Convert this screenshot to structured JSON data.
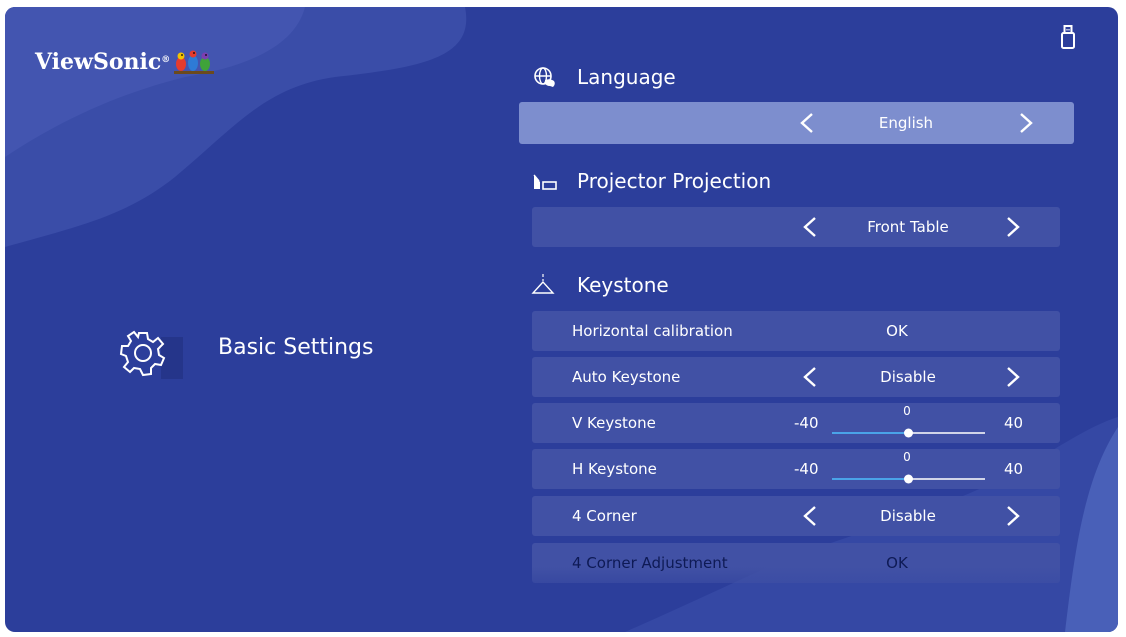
{
  "brand": {
    "name": "ViewSonic",
    "reg": "®",
    "logo_icon": "birds-icon"
  },
  "status": {
    "icon": "usb-icon"
  },
  "page": {
    "title": "Basic Settings",
    "icon": "gear-icon"
  },
  "sections": {
    "language": {
      "title": "Language",
      "icon": "globe-icon",
      "value": "English"
    },
    "projection": {
      "title": "Projector Projection",
      "icon": "projector-icon",
      "value": "Front Table"
    },
    "keystone": {
      "title": "Keystone",
      "icon": "keystone-icon"
    }
  },
  "keystone_rows": {
    "horizontal": {
      "label": "Horizontal calibration",
      "value": "OK"
    },
    "auto": {
      "label": "Auto Keystone",
      "value": "Disable"
    },
    "v": {
      "label": "V Keystone",
      "min": "-40",
      "max": "40",
      "value": "0",
      "level": 0.5
    },
    "h": {
      "label": "H Keystone",
      "min": "-40",
      "max": "40",
      "value": "0",
      "level": 0.5
    },
    "corner": {
      "label": "4 Corner",
      "value": "Disable"
    },
    "corner_adj": {
      "label": "4 Corner Adjustment",
      "value": "OK"
    }
  },
  "colors": {
    "background": "#2c3e9b",
    "row": "#4151a5",
    "selected_row": "#7d8ece",
    "slider_track": "#4aa3e8"
  }
}
